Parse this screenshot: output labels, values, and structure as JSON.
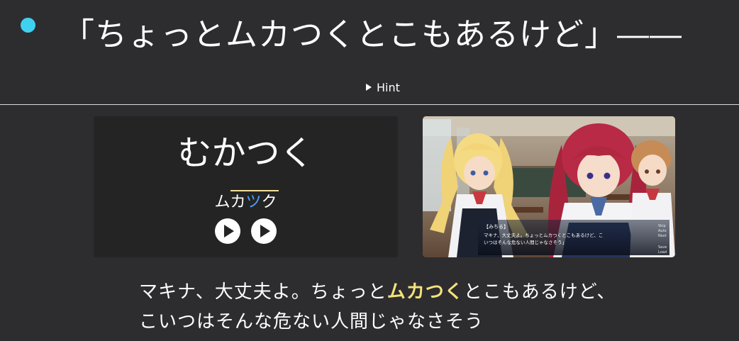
{
  "header": {
    "sentence": "「ちょっとムカつくとこもあるけど」――",
    "indicator_color": "#3fd2f0"
  },
  "hint": {
    "label": "Hint"
  },
  "word_card": {
    "word": "むかつく",
    "kana": {
      "part1": "ムカ",
      "accent": "ツ",
      "part2": "ク"
    },
    "play_buttons": [
      "play",
      "play"
    ],
    "accent_color": "#4aa3ff",
    "pitch_line_color": "#f1df9a"
  },
  "screenshot": {
    "ui_menu": [
      "Skip",
      "Auto",
      "Next",
      "Save",
      "Load"
    ],
    "dialogue_name": "【みちる】",
    "dialogue_line1": "マキナ、大丈夫よ。ちょっとムカつくとこもあるけど、こ",
    "dialogue_line2": "いつはそんな危ない人間じゃなさそう」"
  },
  "bottom_text": {
    "line1_before": "マキナ、大丈夫よ。ちょっと",
    "line1_highlight": "ムカつく",
    "line1_after": "とこもあるけど、",
    "line2": "こいつはそんな危ない人間じゃなさそう",
    "highlight_color": "#f4e27a"
  }
}
